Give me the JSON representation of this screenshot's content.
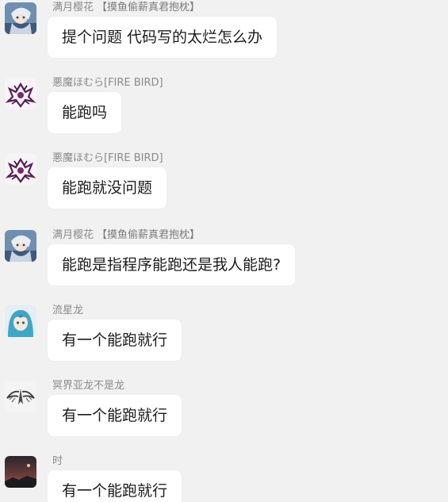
{
  "messages": [
    {
      "sender": "满月樱花",
      "tag": "【摸鱼偷薪真君抱枕】",
      "text": "提个问题 代码写的太烂怎么办",
      "avatar": "anime-girl-avatar"
    },
    {
      "sender": "悪魔ほむら[FIRE BIRD]",
      "tag": "",
      "text": "能跑吗",
      "avatar": "dark-wings-avatar"
    },
    {
      "sender": "悪魔ほむら[FIRE BIRD]",
      "tag": "",
      "text": "能跑就没问题",
      "avatar": "dark-wings-avatar"
    },
    {
      "sender": "满月樱花",
      "tag": "【摸鱼偷薪真君抱枕】",
      "text": "能跑是指程序能跑还是我人能跑?",
      "avatar": "anime-girl-avatar"
    },
    {
      "sender": "流星龙",
      "tag": "",
      "text": "有一个能跑就行",
      "avatar": "blue-hair-avatar"
    },
    {
      "sender": "冥界亚龙不是龙",
      "tag": "",
      "text": "有一个能跑就行",
      "avatar": "wing-sketch-avatar"
    },
    {
      "sender": "时",
      "tag": "",
      "text": "有一个能跑就行",
      "avatar": "dusk-landscape-avatar"
    }
  ],
  "colors": {
    "background": "#f1f1f1",
    "bubble": "#ffffff",
    "sender_name": "#8a8a8a",
    "message_text": "#1c1c1c"
  }
}
